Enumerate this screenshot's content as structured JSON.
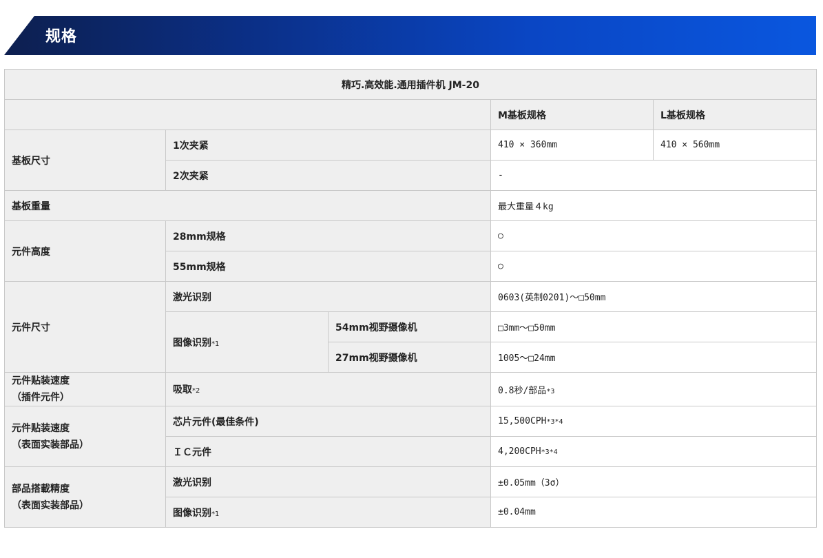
{
  "header": {
    "title": "规格"
  },
  "table": {
    "title": "精巧.高效能.通用插件机 JM-20",
    "col_m": "M基板规格",
    "col_l": "L基板规格",
    "board_size": {
      "label": "基板尺寸",
      "clamp1": {
        "label": "1次夹紧",
        "m": "410 × 360mm",
        "l": "410 × 560mm"
      },
      "clamp2": {
        "label": "2次夹紧",
        "value": "-"
      }
    },
    "board_weight": {
      "label": "基板重量",
      "value": "最大重量４kg"
    },
    "comp_height": {
      "label": "元件高度",
      "r28": {
        "label": "28mm规格",
        "value": "○"
      },
      "r55": {
        "label": "55mm规格",
        "value": "○"
      }
    },
    "comp_size": {
      "label": "元件尺寸",
      "laser": {
        "label": "激光识别",
        "value": "0603(英制0201)～□50mm"
      },
      "image": {
        "label": "图像识别",
        "note": "*1",
        "cam54": {
          "label": "54mm视野摄像机",
          "value": "□3mm～□50mm"
        },
        "cam27": {
          "label": "27mm视野摄像机",
          "value": "1005～□24mm"
        }
      }
    },
    "speed_insert": {
      "label_line1": "元件贴装速度",
      "label_line2": "（插件元件）",
      "pickup": {
        "label": "吸取",
        "note": "*2",
        "value": "0.8秒/部品",
        "value_note": "*3"
      }
    },
    "speed_smt": {
      "label_line1": "元件贴装速度",
      "label_line2": "（表面实装部品）",
      "chip": {
        "label": "芯片元件(最佳条件)",
        "value": "15,500CPH",
        "value_note": "*3*4"
      },
      "ic": {
        "label": "ＩＣ元件",
        "value": "4,200CPH",
        "value_note": "*3*4"
      }
    },
    "accuracy": {
      "label_line1": "部品搭載精度",
      "label_line2": "（表面实装部品）",
      "laser": {
        "label": "激光识别",
        "value": "±0.05mm（3σ）"
      },
      "image": {
        "label": "图像识别",
        "note": "*1",
        "value": "±0.04mm"
      }
    }
  }
}
